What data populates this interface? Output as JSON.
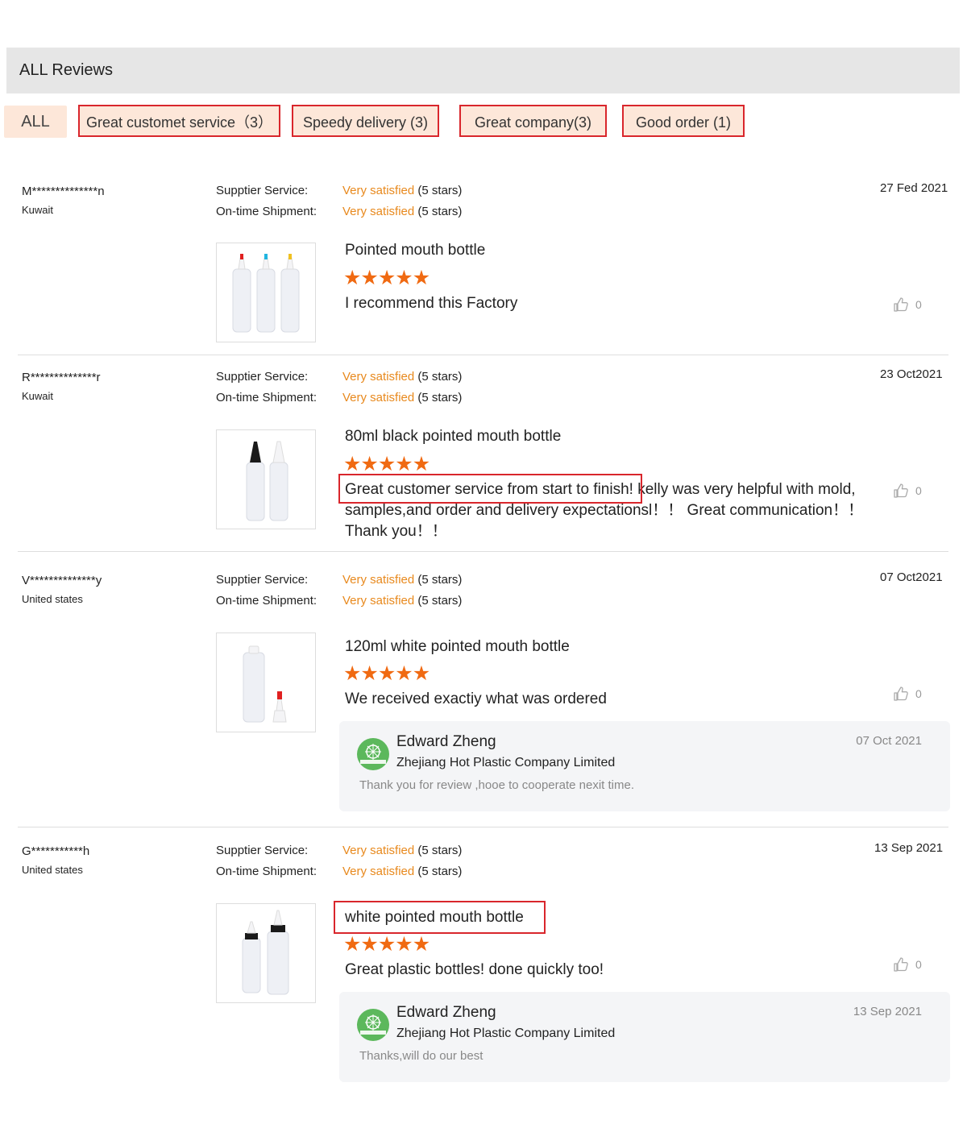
{
  "header": {
    "title": "ALL Reviews"
  },
  "filters": [
    {
      "label": "ALL"
    },
    {
      "label": "Great customet service（3）"
    },
    {
      "label": "Speedy delivery (3)"
    },
    {
      "label": "Great company(3)"
    },
    {
      "label": "Good order (1)"
    }
  ],
  "rating_labels": {
    "supplier": "Supptier Service:",
    "shipment": "On-time Shipment:"
  },
  "reviews": [
    {
      "user": "M**************n",
      "country": "Kuwait",
      "date": "27 Fed 2021",
      "supplier_value": "Very satisfied",
      "supplier_stars": "(5 stars)",
      "shipment_value": "Very satisfied",
      "shipment_stars": "(5 stars)",
      "product_title": "Pointed mouth bottle",
      "rating": 5,
      "comment": "I recommend this Factory",
      "likes": "0"
    },
    {
      "user": "R**************r",
      "country": "Kuwait",
      "date": "23 Oct2021",
      "supplier_value": "Very satisfied",
      "supplier_stars": "(5 stars)",
      "shipment_value": "Very satisfied",
      "shipment_stars": "(5 stars)",
      "product_title": "80ml black pointed mouth bottle",
      "rating": 5,
      "comment_highlight": "Great customer service from start to finish!",
      "comment_rest": " kelly was very helpful with mold, samples,and order and delivery expectationsl！！ Great communication！！ Thank you！！",
      "likes": "0"
    },
    {
      "user": "V**************y",
      "country": "United states",
      "date": "07 Oct2021",
      "supplier_value": "Very satisfied",
      "supplier_stars": "(5 stars)",
      "shipment_value": "Very satisfied",
      "shipment_stars": "(5 stars)",
      "product_title": "120ml white pointed mouth bottle",
      "rating": 5,
      "comment": "We received exactiy what was ordered",
      "likes": "0",
      "reply": {
        "name": "Edward Zheng",
        "company": "Zhejiang Hot Plastic Company Limited",
        "text": "Thank you for review ,hooe to cooperate nexit time.",
        "date": "07 Oct 2021"
      }
    },
    {
      "user": "G***********h",
      "country": "United states",
      "date": "13 Sep 2021",
      "supplier_value": "Very satisfied",
      "supplier_stars": "(5 stars)",
      "shipment_value": "Very satisfied",
      "shipment_stars": "(5 stars)",
      "product_title": "white pointed mouth bottle",
      "rating": 5,
      "comment": "Great plastic bottles! done quickly too!",
      "likes": "0",
      "reply": {
        "name": "Edward Zheng",
        "company": "Zhejiang Hot Plastic Company Limited",
        "text": "Thanks,will do our best",
        "date": "13 Sep 2021"
      }
    }
  ],
  "colors": {
    "accent": "#e8891d",
    "star": "#f06a12",
    "highlight_border": "#d9262c",
    "chip_bg": "#fde7d9",
    "reply_avatar": "#5cb85c"
  },
  "icons": {
    "like": "thumbs-up-icon",
    "star": "star-icon"
  }
}
